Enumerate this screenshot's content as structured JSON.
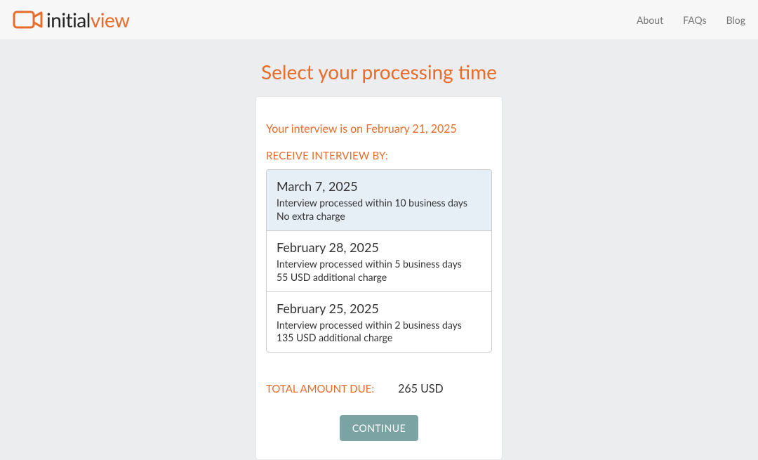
{
  "header": {
    "logo": {
      "initial": "initial",
      "view": "view"
    },
    "nav": {
      "about": "About",
      "faqs": "FAQs",
      "blog": "Blog"
    }
  },
  "page": {
    "title": "Select your processing time"
  },
  "card": {
    "interview_date": "Your interview is on February 21, 2025",
    "receive_label": "RECEIVE INTERVIEW BY:",
    "options": [
      {
        "date": "March 7, 2025",
        "desc": "Interview processed within 10 business days",
        "charge": "No extra charge",
        "selected": true
      },
      {
        "date": "February 28, 2025",
        "desc": "Interview processed within 5 business days",
        "charge": "55 USD additional charge",
        "selected": false
      },
      {
        "date": "February 25, 2025",
        "desc": "Interview processed within 2 business days",
        "charge": "135 USD additional charge",
        "selected": false
      }
    ],
    "total_label": "TOTAL AMOUNT DUE:",
    "total_amount": "265 USD",
    "continue_label": "CONTINUE"
  }
}
